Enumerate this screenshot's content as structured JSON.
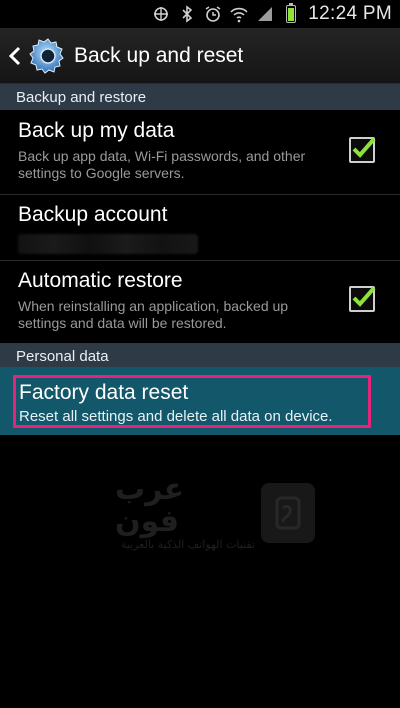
{
  "status_bar": {
    "time": "12:24 PM",
    "icons": [
      "location-sync-icon",
      "bluetooth-icon",
      "alarm-icon",
      "wifi-icon",
      "signal-icon",
      "battery-icon"
    ]
  },
  "action_bar": {
    "title": "Back up and reset",
    "icon": "settings-gear-icon"
  },
  "sections": [
    {
      "header": "Backup and restore",
      "items": [
        {
          "title": "Back up my data",
          "subtitle": "Back up app data, Wi-Fi passwords, and other settings to Google servers.",
          "checked": true
        },
        {
          "title": "Backup account",
          "subtitle": "",
          "checked": null
        },
        {
          "title": "Automatic restore",
          "subtitle": "When reinstalling an application, backed up settings and data will be restored.",
          "checked": true
        }
      ]
    },
    {
      "header": "Personal data",
      "items": [
        {
          "title": "Factory data reset",
          "subtitle": "Reset all settings and delete all data on device.",
          "highlighted": true
        }
      ]
    }
  ],
  "colors": {
    "section_bg": "#2f3a47",
    "highlight_bg": "#12586a",
    "highlight_border": "#e6237a",
    "check_green": "#8ee33b"
  },
  "watermark": {
    "big": "عرب فون",
    "small": "تقنيات الهواتف الذكية بالعربية"
  }
}
